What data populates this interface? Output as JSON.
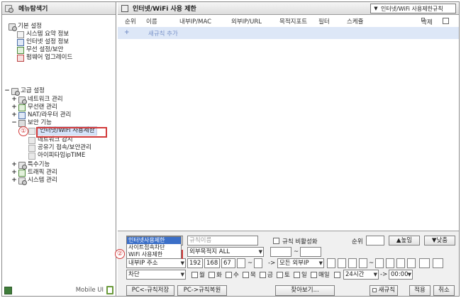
{
  "left": {
    "title": "메뉴탐색기",
    "tree": {
      "basic": "기본 설정",
      "basic_items": [
        "시스템 요약 정보",
        "인터넷 설정 정보",
        "무선 설정/보안",
        "펌웨어 업그레이드"
      ],
      "advanced": "고급 설정",
      "advanced_items": [
        "네트워크 관리",
        "무선랜 관리",
        "NAT/라우터 관리"
      ],
      "security": "보안 기능",
      "security_items": [
        "인터넷/WiFi 사용제한",
        "네트워크 감시",
        "공유기 접속/보안관리",
        "아이피타임ipTIME"
      ],
      "advanced_items_after": [
        "특수기능",
        "트래픽 관리",
        "시스템 관리"
      ]
    },
    "callout1": "①",
    "footer": {
      "mobile_label": "Mobile UI"
    }
  },
  "right": {
    "title": "인터넷/WiFi 사용 제한",
    "header_select": "인터넷/WiFi 사용제한규칙",
    "columns": [
      "순위",
      "이름",
      "내부IP/MAC",
      "외부IP/URL",
      "목적지포트",
      "필터",
      "스케쥴",
      "삭제"
    ],
    "new_rule": {
      "plus": "+",
      "label": "새규칙 추가"
    },
    "form": {
      "dropdown_options": [
        "인터넷사용제한",
        "사이트접속차단",
        "WiFi 사용제한"
      ],
      "dropdown_selected_index": 0,
      "callout2": "②",
      "rule_name_placeholder": "규칙이름",
      "disable_rule_label": "규칙 비활성화",
      "priority_label": "순위",
      "up_button": "▲높임",
      "down_button": "▼낮춤",
      "dest_select": "외부목적지 ALL",
      "tilde": "~",
      "internal_ip_select": "내부IP 주소",
      "ip_parts": [
        "192",
        "168",
        "67",
        ""
      ],
      "arrow": "->",
      "all_external": "모든 외부IP",
      "block_select": "차단",
      "weekdays": [
        "월",
        "화",
        "수",
        "목",
        "금",
        "토",
        "일",
        "매일"
      ],
      "time_select": "24시간",
      "time_from": "00:00"
    },
    "buttons": {
      "pc_save": "PC<-규칙저장",
      "pc_restore": "PC->규칙복원",
      "browse": "찾아보기...",
      "new_rule": "새규칙",
      "apply": "적용",
      "cancel": "취소"
    }
  }
}
